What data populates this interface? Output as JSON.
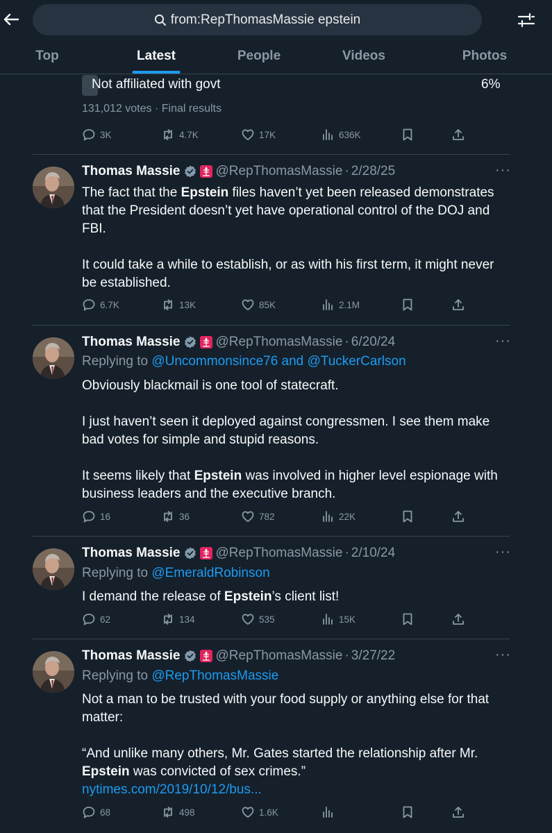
{
  "search": {
    "query": "from:RepThomasMassie epstein"
  },
  "tabs": [
    "Top",
    "Latest",
    "People",
    "Videos",
    "Photos"
  ],
  "active_tab": "Latest",
  "poll": {
    "option_label": "Not affiliated with govt",
    "option_pct": "6%",
    "meta": "131,012 votes · Final results",
    "stats": {
      "replies": "3K",
      "reposts": "4.7K",
      "likes": "17K",
      "views": "636K"
    }
  },
  "tweets": [
    {
      "name": "Thomas Massie",
      "handle": "@RepThomasMassie",
      "date": "2/28/25",
      "replying_prefix": "",
      "replying_to": "",
      "lines": [
        [
          "The fact that the ",
          "Epstein",
          " files haven’t yet been released demonstrates"
        ],
        "that the President doesn’t yet have operational control of the DOJ and",
        "FBI.",
        "",
        "It could take a while to establish, or as with his first term, it might never",
        "be established."
      ],
      "stats": {
        "replies": "6.7K",
        "reposts": "13K",
        "likes": "85K",
        "views": "2.1M"
      }
    },
    {
      "name": "Thomas Massie",
      "handle": "@RepThomasMassie",
      "date": "6/20/24",
      "replying_prefix": "Replying to ",
      "replying_to": "@Uncommonsince76 and @TuckerCarlson",
      "lines": [
        "Obviously blackmail is one tool of statecraft.",
        "",
        "I just haven’t seen it deployed against congressmen. I see them make",
        "bad votes for simple and stupid reasons.",
        "",
        [
          "It seems likely that ",
          "Epstein",
          " was involved in higher level espionage with"
        ],
        "business leaders and the executive branch."
      ],
      "stats": {
        "replies": "16",
        "reposts": "36",
        "likes": "782",
        "views": "22K"
      }
    },
    {
      "name": "Thomas Massie",
      "handle": "@RepThomasMassie",
      "date": "2/10/24",
      "replying_prefix": "Replying to ",
      "replying_to": "@EmeraldRobinson",
      "lines": [
        [
          "I demand the release of ",
          "Epstein",
          "’s client list!"
        ]
      ],
      "stats": {
        "replies": "62",
        "reposts": "134",
        "likes": "535",
        "views": "15K"
      }
    },
    {
      "name": "Thomas Massie",
      "handle": "@RepThomasMassie",
      "date": "3/27/22",
      "replying_prefix": "Replying to ",
      "replying_to": "@RepThomasMassie",
      "lines": [
        "Not a man to be trusted with your food supply or anything else for that",
        "matter:",
        "",
        "“And unlike many others, Mr. Gates started the relationship after Mr.",
        [
          "",
          "Epstein",
          " was convicted of sex crimes.”"
        ]
      ],
      "url": "nytimes.com/2019/10/12/bus...",
      "stats": {
        "replies": "68",
        "reposts": "498",
        "likes": "1.6K",
        "views": ""
      }
    }
  ],
  "colors": {
    "background": "#15202b",
    "accent": "#1d9bf0",
    "muted": "#8b98a5",
    "divider": "#38444d",
    "flag_red": "#e0245e"
  }
}
